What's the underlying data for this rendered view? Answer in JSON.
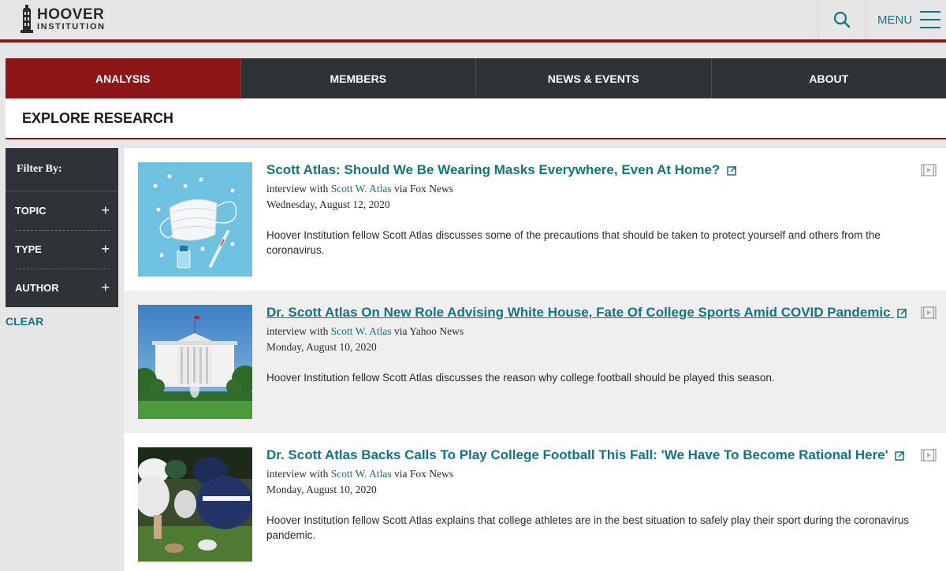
{
  "header": {
    "logo_line1": "HOOVER",
    "logo_line2": "INSTITUTION",
    "search_icon": "search-icon",
    "menu_label": "MENU",
    "menu_icon": "hamburger-icon"
  },
  "nav": {
    "tabs": [
      {
        "label": "ANALYSIS",
        "active": true
      },
      {
        "label": "MEMBERS",
        "active": false
      },
      {
        "label": "NEWS & EVENTS",
        "active": false
      },
      {
        "label": "ABOUT",
        "active": false
      }
    ]
  },
  "section": {
    "title": "EXPLORE RESEARCH"
  },
  "filter": {
    "title": "Filter By:",
    "items": [
      {
        "label": "TOPIC",
        "icon": "plus-icon",
        "symbol": "+"
      },
      {
        "label": "TYPE",
        "icon": "plus-icon",
        "symbol": "+"
      },
      {
        "label": "AUTHOR",
        "icon": "plus-icon",
        "symbol": "+"
      }
    ],
    "clear_label": "CLEAR"
  },
  "results": [
    {
      "title": "Scott Atlas: Should We Be Wearing Masks Everywhere, Even At Home?",
      "meta_prefix": "interview with",
      "author": "Scott W. Atlas",
      "meta_suffix": "via Fox News",
      "date": "Wednesday, August 12, 2020",
      "description": "Hoover Institution fellow Scott Atlas discusses some of the precautions that should be taken to protect yourself and others from the coronavirus.",
      "thumbnail": "face-mask-photo",
      "type_icon": "video-icon"
    },
    {
      "title": "Dr. Scott Atlas On New Role Advising White House, Fate Of College Sports Amid COVID Pandemic",
      "meta_prefix": "interview with",
      "author": "Scott W. Atlas",
      "meta_suffix": "via Yahoo News",
      "date": "Monday, August 10, 2020",
      "description": "Hoover Institution fellow Scott Atlas discusses the reason why college football should be played this season.",
      "thumbnail": "white-house-photo",
      "type_icon": "video-icon"
    },
    {
      "title": "Dr. Scott Atlas Backs Calls To Play College Football This Fall: 'We Have To Become Rational Here'",
      "meta_prefix": "interview with",
      "author": "Scott W. Atlas",
      "meta_suffix": "via Fox News",
      "date": "Monday, August 10, 2020",
      "description": "Hoover Institution fellow Scott Atlas explains that college athletes are in the best situation to safely play their sport during the coronavirus pandemic.",
      "thumbnail": "football-players-photo",
      "type_icon": "video-icon"
    }
  ],
  "colors": {
    "brand_red": "#8c1515",
    "dark_nav": "#2f3236",
    "link_teal": "#127580"
  }
}
